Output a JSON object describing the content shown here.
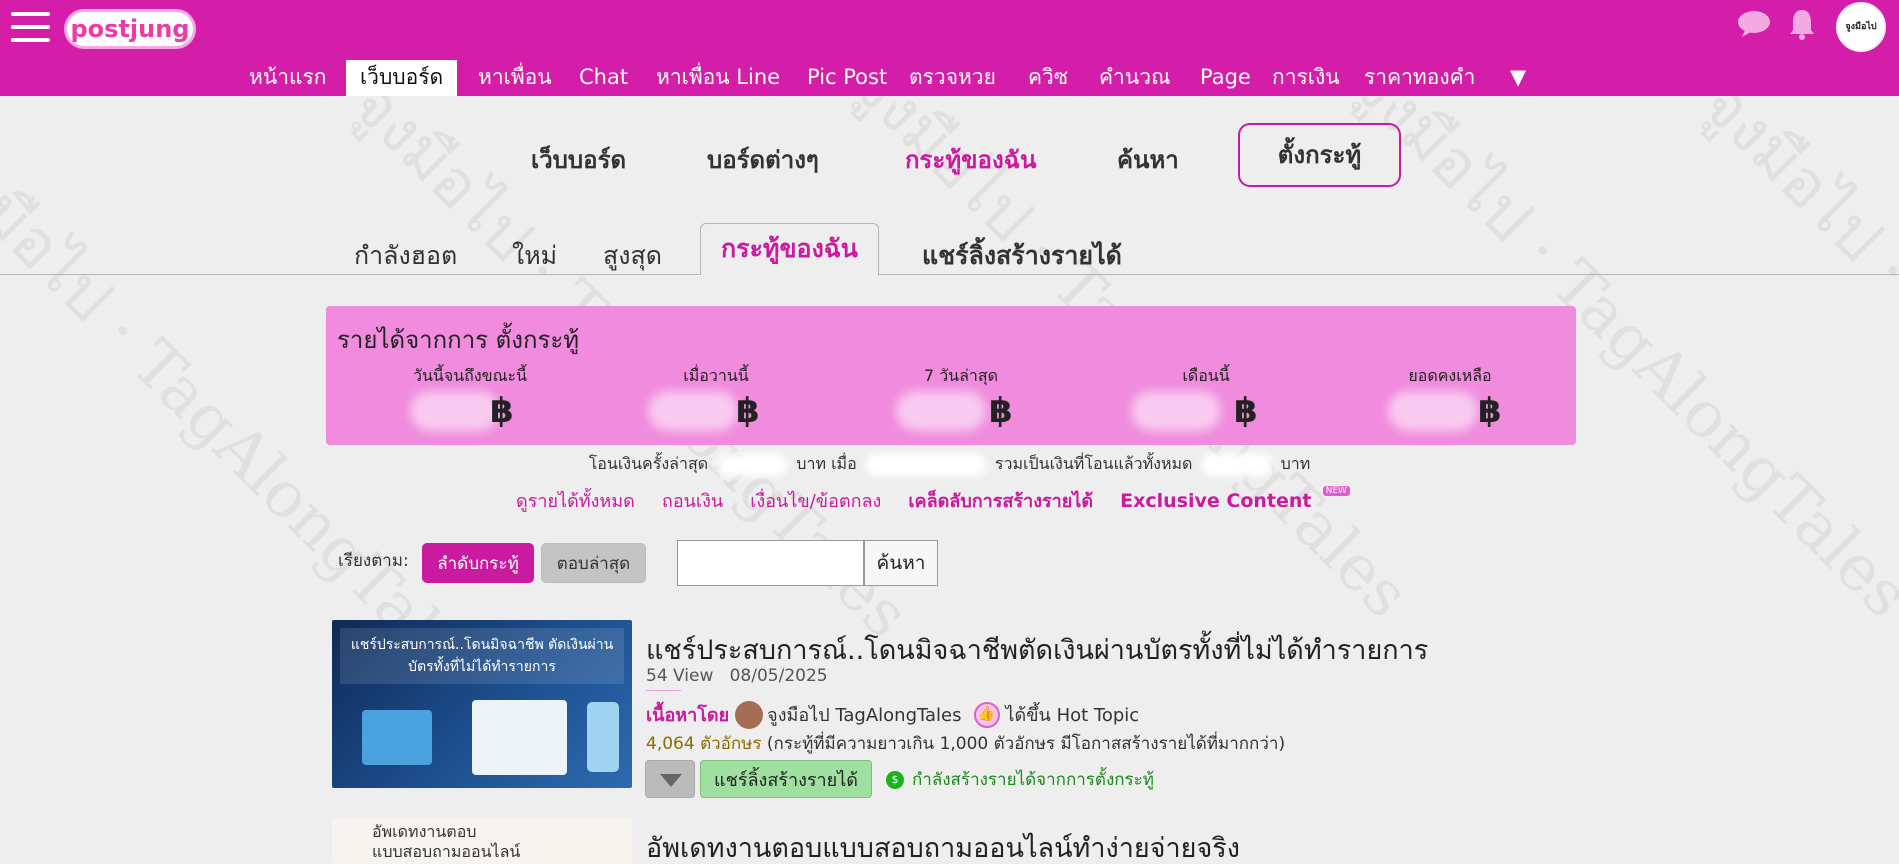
{
  "app": {
    "logo_text": "postjung",
    "avatar_text": "จูงมือไป"
  },
  "topnav": {
    "items": [
      "หน้าแรก",
      "เว็บบอร์ด",
      "หาเพื่อน",
      "Chat",
      "หาเพื่อน Line",
      "Pic Post",
      "ตรวจหวย",
      "ควิซ",
      "คำนวณ",
      "Page",
      "การเงิน",
      "ราคาทองคำ",
      "▼"
    ],
    "active": "เว็บบอร์ด"
  },
  "board_nav": {
    "webboard": "เว็บบอร์ด",
    "boards": "บอร์ดต่างๆ",
    "my_topics": "กระทู้ของฉัน",
    "search": "ค้นหา",
    "new_topic": "ตั้งกระทู้"
  },
  "tabs": {
    "hot": "กำลังฮอต",
    "new": "ใหม่",
    "top": "สูงสุด",
    "mine": "กระทู้ของฉัน",
    "share": "แชร์ลิ้งสร้างรายได้"
  },
  "income": {
    "title": "รายได้จากการ ตั้งกระทู้",
    "currency": "฿",
    "columns": [
      "วันนี้จนถึงขณะนี้",
      "เมื่อวานนี้",
      "7 วันล่าสุด",
      "เดือนนี้",
      "ยอดคงเหลือ"
    ]
  },
  "transfer": {
    "last_label": "โอนเงินครั้งล่าสุด",
    "baht": "บาท",
    "when": "เมื่อ",
    "total_label": "รวมเป็นเงินที่โอนแล้วทั้งหมด"
  },
  "links": {
    "all_income": "ดูรายได้ทั้งหมด",
    "withdraw": "ถอนเงิน",
    "terms": "เงื่อนไข/ข้อตกลง",
    "tips": "เคล็ดลับการสร้างรายได้",
    "exclusive": "Exclusive Content",
    "new_badge": "NEW"
  },
  "sort": {
    "label": "เรียงตาม:",
    "by_order": "ลำดับกระทู้",
    "by_latest_reply": "ตอบล่าสุด"
  },
  "search": {
    "placeholder": "",
    "button": "ค้นหา"
  },
  "posts": [
    {
      "thumb_caption": "แชร์ประสบการณ์..โดนมิจฉาชีพ ตัดเงินผ่านบัตรทั้งที่ไม่ได้ทำรายการ",
      "title": "แชร์ประสบการณ์..โดนมิจฉาชีพตัดเงินผ่านบัตรทั้งที่ไม่ได้ทำรายการ",
      "views": "54 View",
      "date": "08/05/2025",
      "by_label": "เนื้อหาโดย",
      "author": "จูงมือไป TagAlongTales",
      "hot_label": "ได้ขึ้น Hot Topic",
      "length_count": "4,064 ตัวอักษร",
      "length_note": "(กระทู้ที่มีความยาวเกิน 1,000 ตัวอักษร มีโอกาสสร้างรายได้ที่มากกว่า)",
      "share_button": "แชร์ลิ้งสร้างรายได้",
      "earning_status": "กำลังสร้างรายได้จากการตั้งกระทู้"
    },
    {
      "thumb_caption": "อัพเดทงานตอบ\nแบบสอบถามออนไลน์",
      "title": "อัพเดทงานตอบแบบสอบถามออนไลน์ทำง่ายจ่ายจริง"
    }
  ],
  "colors": {
    "brand": "#d41ea9",
    "accent": "#c91aa0",
    "income_bg": "#f08bdd",
    "success": "#1a8a1a"
  }
}
